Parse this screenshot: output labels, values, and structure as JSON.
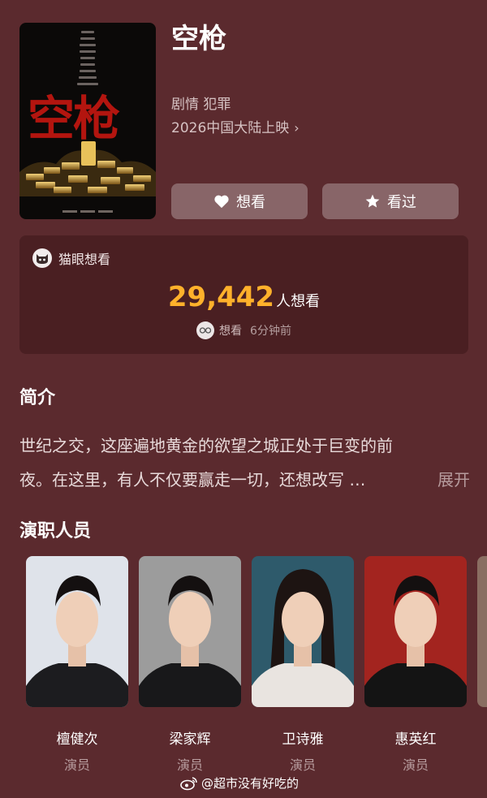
{
  "movie": {
    "title": "空枪",
    "poster_title": "空枪",
    "genre": "剧情 犯罪",
    "release": "2026中国大陆上映",
    "release_chevron": "›"
  },
  "actions": {
    "want_label": "想看",
    "seen_label": "看过"
  },
  "want_card": {
    "brand": "猫眼想看",
    "count": "29,442",
    "count_unit": "人想看",
    "recent_action": "想看",
    "recent_time": "6分钟前"
  },
  "intro": {
    "heading": "简介",
    "line1": "世纪之交，这座遍地黄金的欲望之城正处于巨变的前",
    "line2": "夜。在这里，有人不仅要赢走一切，还想改写 …",
    "expand": "展开"
  },
  "cast": {
    "heading": "演职人员",
    "members": [
      {
        "name": "檀健次",
        "role": "演员",
        "bg": "#dfe3ea",
        "shirt": "#1c1c1f"
      },
      {
        "name": "梁家辉",
        "role": "演员",
        "bg": "#9c9c9c",
        "shirt": "#18181a"
      },
      {
        "name": "卫诗雅",
        "role": "演员",
        "bg": "#2e5a6b",
        "shirt": "#e9e4e0"
      },
      {
        "name": "惠英红",
        "role": "演员",
        "bg": "#a3241f",
        "shirt": "#141414"
      }
    ]
  },
  "watermark": {
    "text": "@超市没有好吃的"
  },
  "colors": {
    "background": "#5b2a2e",
    "card": "#4a1f22",
    "count": "#ffb12b"
  }
}
